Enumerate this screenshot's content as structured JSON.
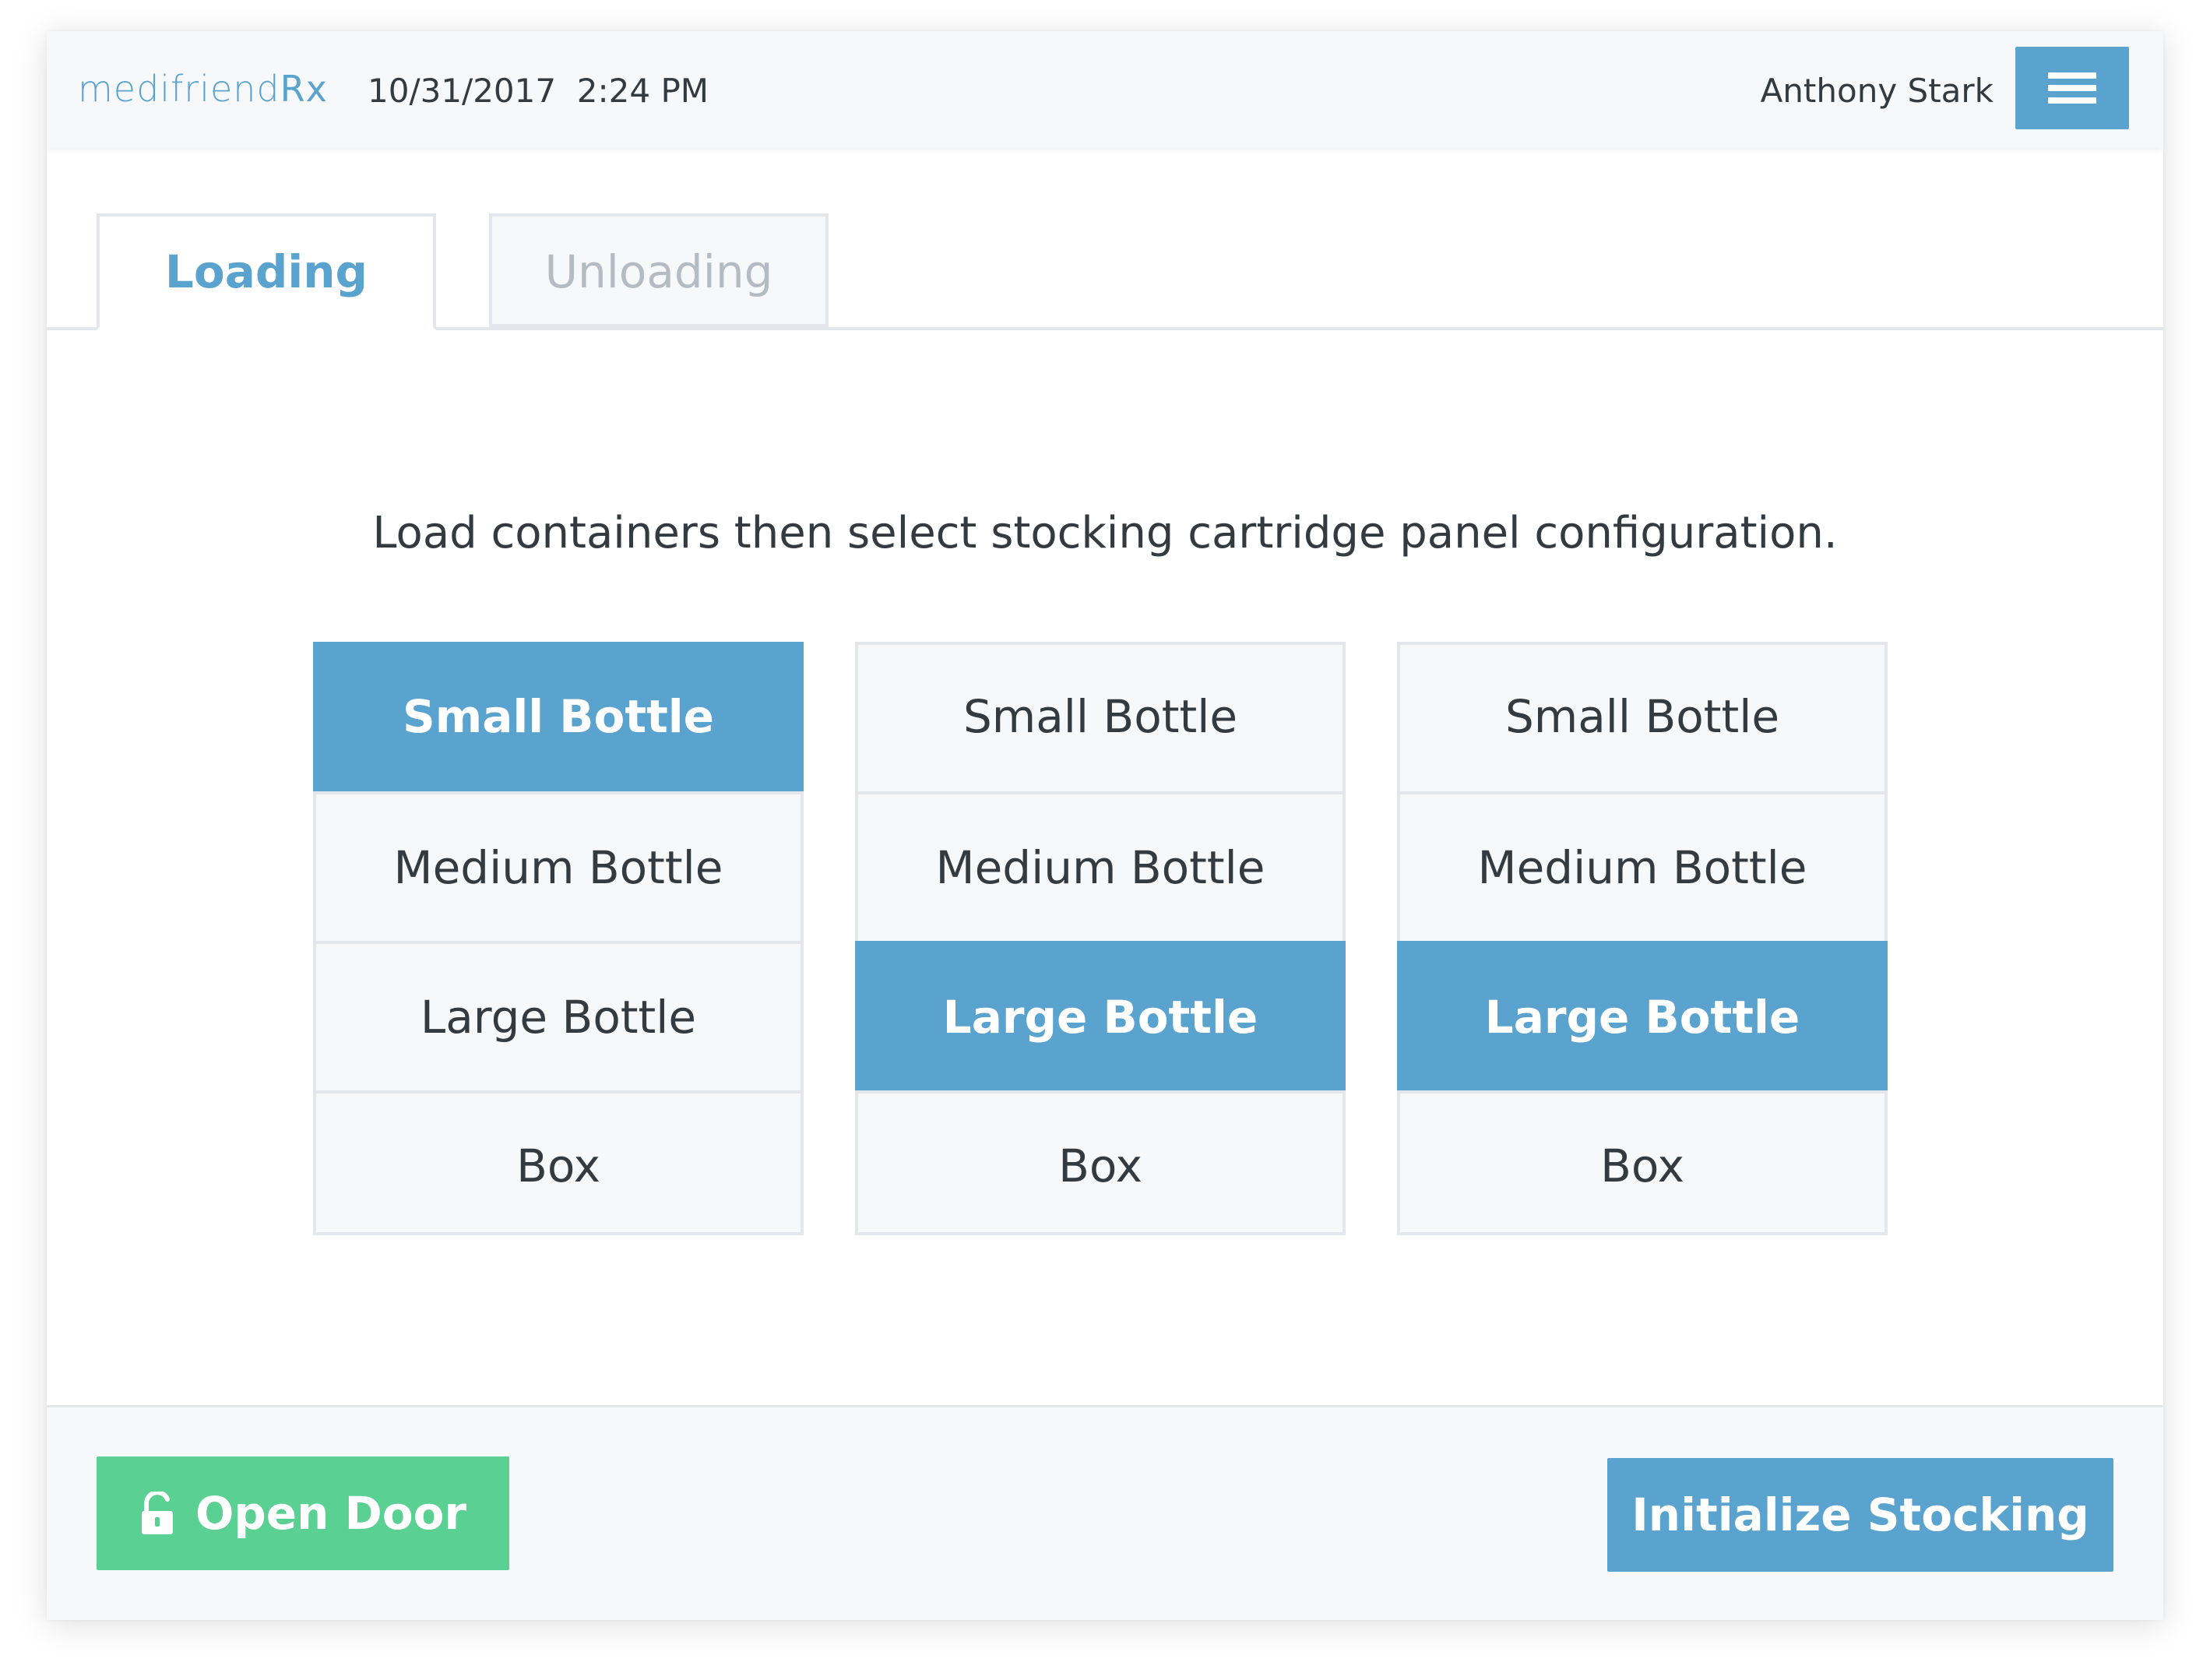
{
  "header": {
    "logo_part1": "medifriend",
    "logo_part2": "Rx",
    "datetime": "10/31/2017  2:24 PM",
    "user_name": "Anthony Stark",
    "menu_icon": "hamburger-menu-icon"
  },
  "tabs": [
    {
      "label": "Loading",
      "active": true
    },
    {
      "label": "Unloading",
      "active": false
    }
  ],
  "instruction": "Load containers then select stocking cartridge panel configuration.",
  "panels": [
    {
      "options": [
        "Small Bottle",
        "Medium Bottle",
        "Large Bottle",
        "Box"
      ],
      "selected": "Small Bottle"
    },
    {
      "options": [
        "Small Bottle",
        "Medium Bottle",
        "Large Bottle",
        "Box"
      ],
      "selected": "Large Bottle"
    },
    {
      "options": [
        "Small Bottle",
        "Medium Bottle",
        "Large Bottle",
        "Box"
      ],
      "selected": "Large Bottle"
    }
  ],
  "footer": {
    "open_door_label": "Open Door",
    "open_door_icon": "unlock-icon",
    "initialize_label": "Initialize Stocking"
  },
  "colors": {
    "accent": "#5aa3cf",
    "success": "#5ad092",
    "border": "#e3e6ea",
    "background_light": "#f7f8fa"
  }
}
